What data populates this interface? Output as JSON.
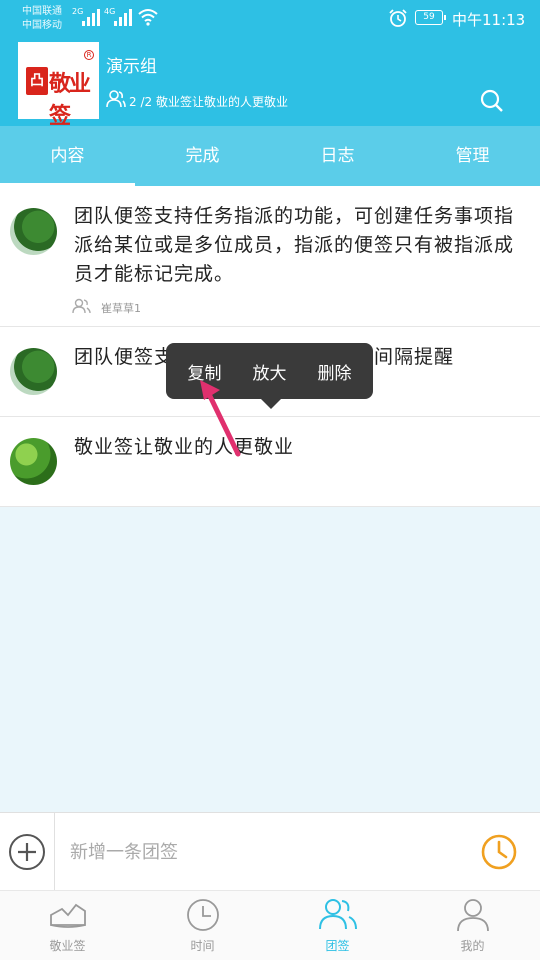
{
  "status_bar": {
    "carrier1": "中国联通",
    "carrier2": "中国移动",
    "net1": "2G",
    "net2": "4G",
    "battery": "59",
    "time": "中午11:13"
  },
  "header": {
    "logo_text": "敬业签",
    "group_name": "演示组",
    "group_info": "2 /2 敬业签让敬业的人更敬业"
  },
  "tabs": [
    {
      "label": "内容",
      "active": true
    },
    {
      "label": "完成",
      "active": false
    },
    {
      "label": "日志",
      "active": false
    },
    {
      "label": "管理",
      "active": false
    }
  ],
  "items": [
    {
      "text": "团队便签支持任务指派的功能，可创建任务事项指派给某位或是多位成员，指派的便签只有被指派成员才能标记完成。",
      "assignee": "崔草草1"
    },
    {
      "text": "团队便签支持重复提醒、重要事项间隔提醒"
    },
    {
      "text": "敬业签让敬业的人更敬业"
    }
  ],
  "context_menu": [
    "复制",
    "放大",
    "删除"
  ],
  "compose": {
    "placeholder": "新增一条团签"
  },
  "bottom_nav": [
    {
      "label": "敬业签",
      "icon": "note-icon",
      "active": false
    },
    {
      "label": "时间",
      "icon": "clock-icon",
      "active": false
    },
    {
      "label": "团签",
      "icon": "team-icon",
      "active": true
    },
    {
      "label": "我的",
      "icon": "profile-icon",
      "active": false
    }
  ],
  "colors": {
    "accent": "#2ec0e4",
    "tab_bar": "#5bcde9",
    "menu_bg": "#3a3a3a",
    "arrow": "#e0306e",
    "clock": "#f0a020"
  }
}
